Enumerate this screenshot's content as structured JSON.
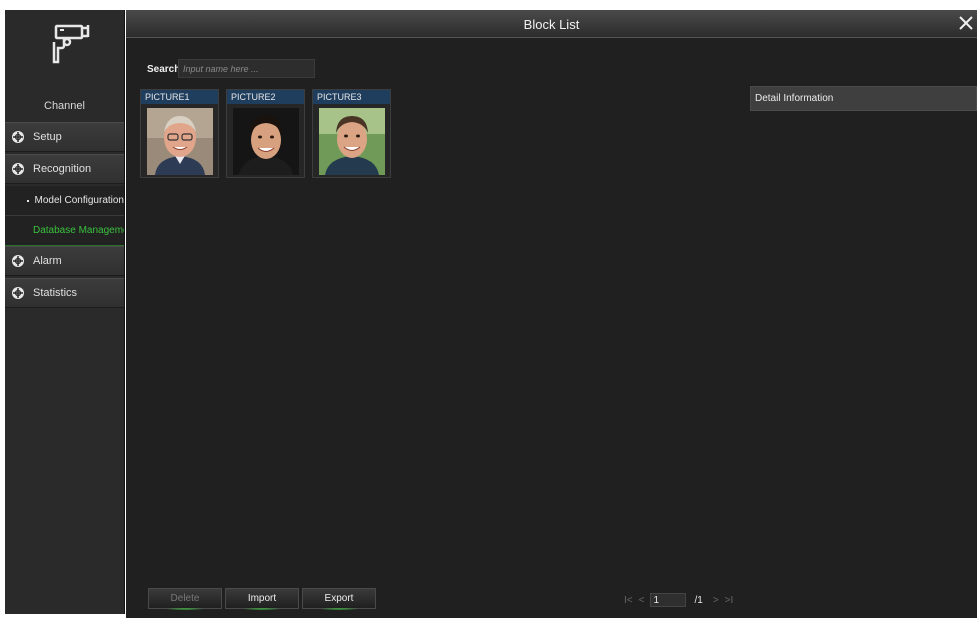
{
  "window": {
    "title": "Block List"
  },
  "sidebar": {
    "channel_label": "Channel",
    "menu": [
      {
        "label": "Setup",
        "icon": "crosshair-icon"
      },
      {
        "label": "Recognition",
        "icon": "crosshair-icon"
      },
      {
        "label": "Alarm",
        "icon": "crosshair-icon"
      },
      {
        "label": "Statistics",
        "icon": "crosshair-icon"
      }
    ],
    "submenu": [
      {
        "label": "Model Configuration"
      },
      {
        "label": "Database Management"
      }
    ]
  },
  "search": {
    "label": "Search",
    "placeholder": "Input name here ..."
  },
  "pictures": [
    {
      "name": "PICTURE1"
    },
    {
      "name": "PICTURE2"
    },
    {
      "name": "PICTURE3"
    }
  ],
  "detail": {
    "title": "Detail Information"
  },
  "buttons": {
    "delete": "Delete",
    "import": "Import",
    "export": "Export"
  },
  "pager": {
    "current": "1",
    "total": "/1",
    "first": "I<",
    "prev": "<",
    "next": ">",
    "last": ">I"
  },
  "colors": {
    "active": "#39c23d",
    "card_header": "#1f3e5e"
  }
}
